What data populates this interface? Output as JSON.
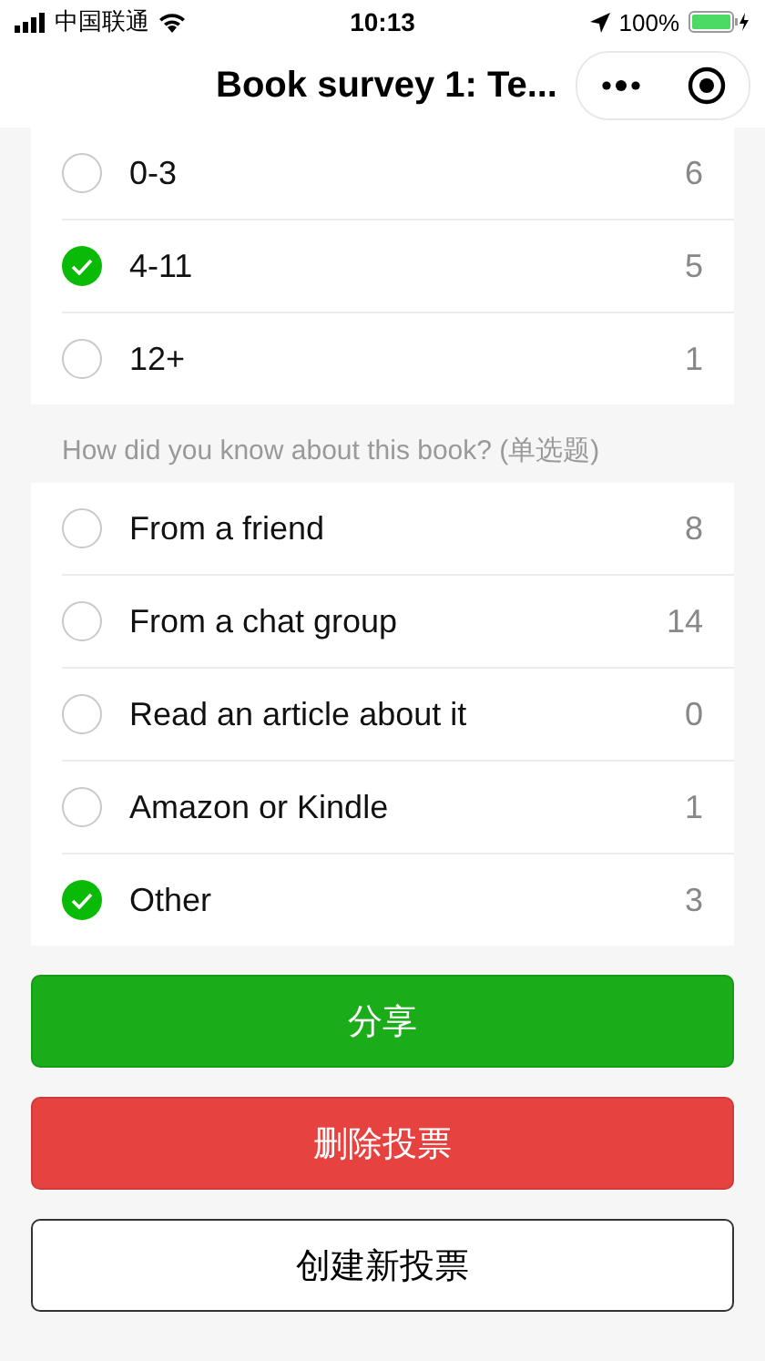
{
  "status_bar": {
    "carrier": "中国联通",
    "time": "10:13",
    "battery": "100%"
  },
  "nav": {
    "title": "Book survey 1: Te..."
  },
  "questions": [
    {
      "options": [
        {
          "label": "0-3",
          "count": "6",
          "selected": false
        },
        {
          "label": "4-11",
          "count": "5",
          "selected": true
        },
        {
          "label": "12+",
          "count": "1",
          "selected": false
        }
      ]
    },
    {
      "prompt": "How did you know about this book? (单选题)",
      "options": [
        {
          "label": "From a friend",
          "count": "8",
          "selected": false
        },
        {
          "label": "From a chat group",
          "count": "14",
          "selected": false
        },
        {
          "label": "Read an article about it",
          "count": "0",
          "selected": false
        },
        {
          "label": "Amazon or Kindle",
          "count": "1",
          "selected": false
        },
        {
          "label": "Other",
          "count": "3",
          "selected": true
        }
      ]
    }
  ],
  "buttons": [
    {
      "label": "分享",
      "kind": "primary"
    },
    {
      "label": "删除投票",
      "kind": "danger"
    },
    {
      "label": "创建新投票",
      "kind": "default"
    }
  ]
}
